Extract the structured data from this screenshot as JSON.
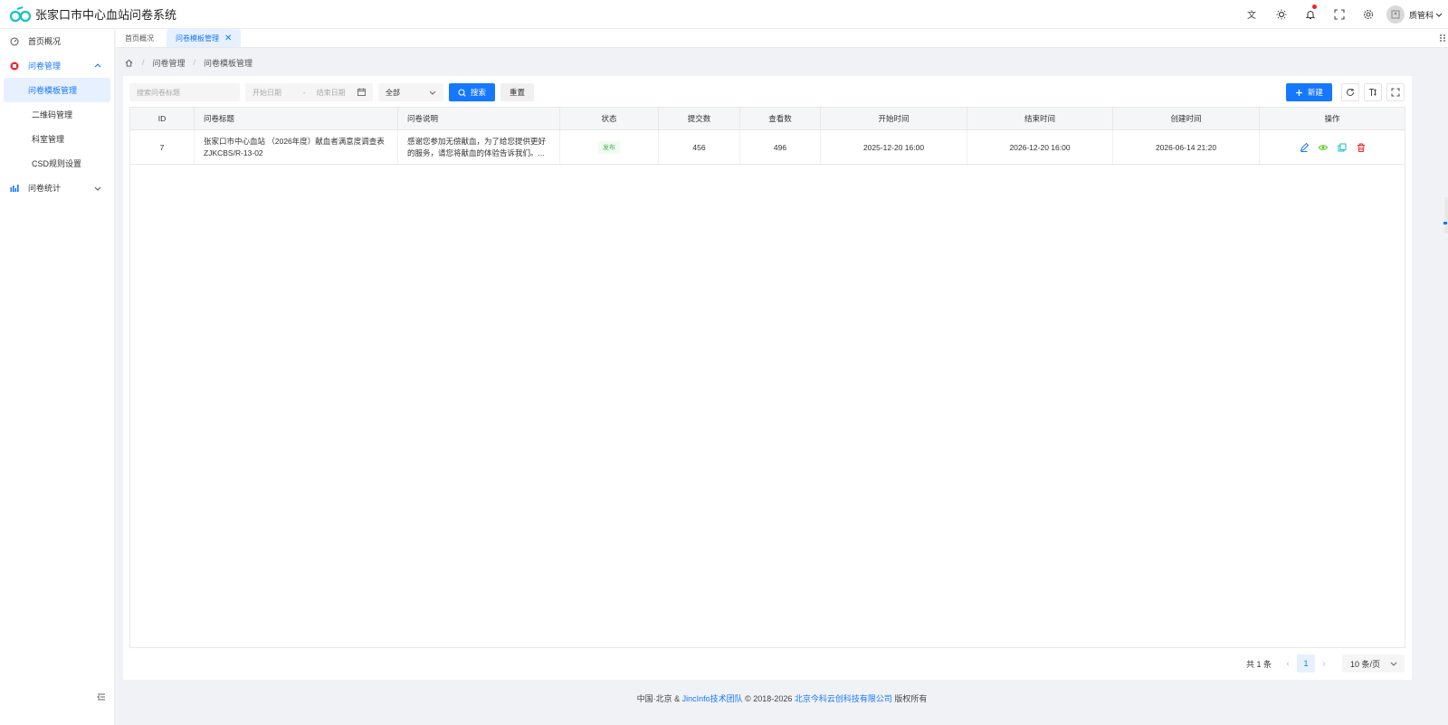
{
  "app": {
    "title": "张家口市中心血站问卷系统"
  },
  "header": {
    "icons": [
      "translate-icon",
      "theme-sun-icon",
      "bell-icon",
      "fullscreen-icon",
      "settings-icon"
    ],
    "user_name": "质管科"
  },
  "sidebar": {
    "items": [
      {
        "label": "首页概况",
        "icon": "dashboard-icon"
      },
      {
        "label": "问卷管理",
        "icon": "questionnaire-icon",
        "expanded": true,
        "children": [
          {
            "label": "问卷模板管理",
            "active": true
          },
          {
            "label": "二维码管理"
          },
          {
            "label": "科室管理"
          },
          {
            "label": "CSD规则设置"
          }
        ]
      },
      {
        "label": "问卷统计",
        "icon": "bar-chart-icon",
        "expanded": false
      }
    ]
  },
  "tabs": [
    {
      "label": "首页概况",
      "active": false
    },
    {
      "label": "问卷模板管理",
      "active": true,
      "closable": true
    }
  ],
  "breadcrumb": [
    "问卷管理",
    "问卷模板管理"
  ],
  "toolbar": {
    "search_placeholder": "搜索问卷标题",
    "start_date_placeholder": "开始日期",
    "date_separator": "-",
    "end_date_placeholder": "结束日期",
    "status_select_value": "全部",
    "search_label": "搜索",
    "reset_label": "重置",
    "new_label": "新建"
  },
  "table": {
    "columns": [
      "ID",
      "问卷标题",
      "问卷说明",
      "状态",
      "提交数",
      "查看数",
      "开始时间",
      "结束时间",
      "创建时间",
      "操作"
    ],
    "rows": [
      {
        "id": "7",
        "title_line1": "张家口市中心血站 （2026年度）献血者满意度调查表",
        "title_line2": "ZJKCBS/R-13-02",
        "desc_line1": "感谢您参加无偿献血，为了给您提供更好",
        "desc_line2": "的服务，请您将献血的体验告诉我们。...",
        "status": "发布",
        "submits": "456",
        "views": "496",
        "start": "2025-12-20 16:00",
        "end": "2026-12-20 16:00",
        "created": "2026-06-14 21:20"
      }
    ]
  },
  "pagination": {
    "total_text": "共 1 条",
    "current_page": "1",
    "page_size": "10 条/页"
  },
  "footer": {
    "prefix": "中国·北京 & ",
    "team": "JincInfo技术团队",
    "copyright": " © 2018-2026 ",
    "company": "北京今科云创科技有限公司",
    "suffix": " 版权所有"
  },
  "colors": {
    "primary": "#1677ff",
    "danger": "#f5222d",
    "success": "#52c41a"
  }
}
